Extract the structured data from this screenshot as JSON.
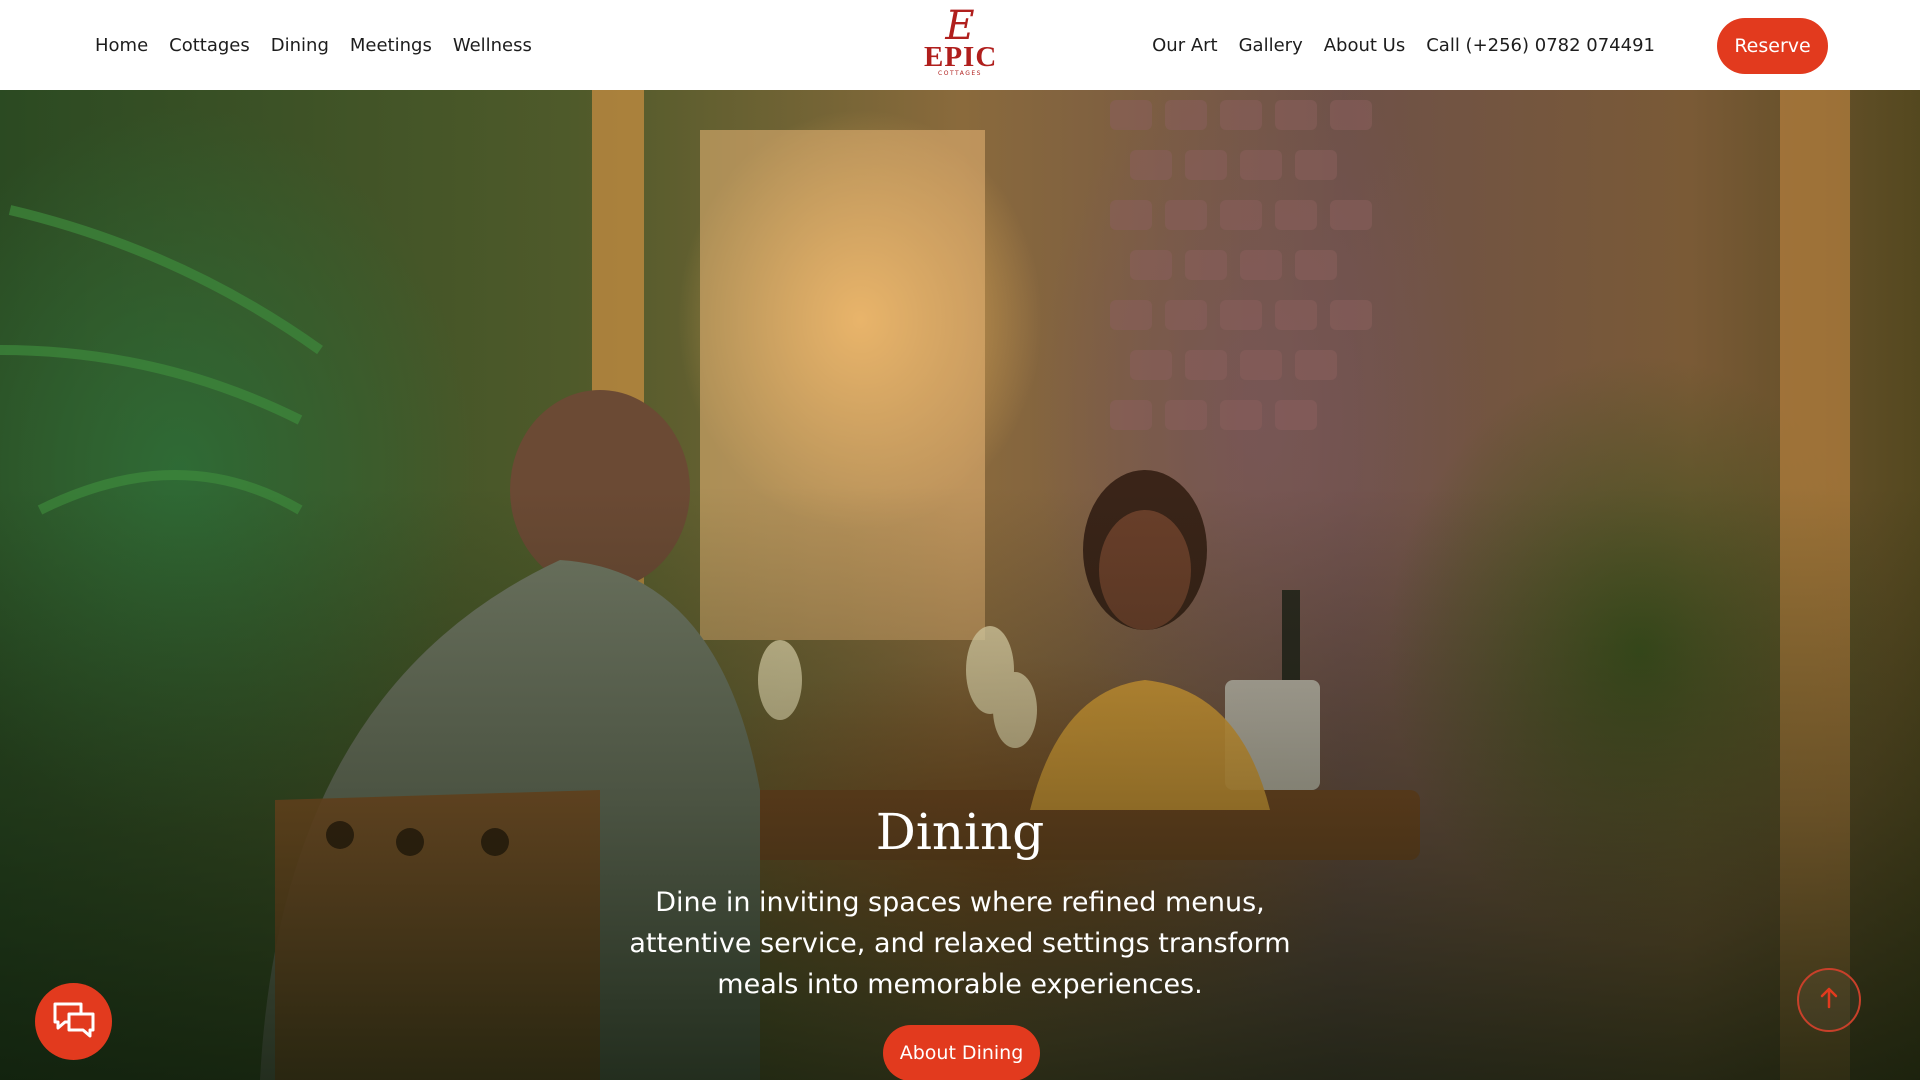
{
  "header": {
    "nav_left": [
      {
        "label": "Home"
      },
      {
        "label": "Cottages"
      },
      {
        "label": "Dining"
      },
      {
        "label": "Meetings"
      },
      {
        "label": "Wellness"
      }
    ],
    "logo": {
      "script_letter": "E",
      "wordmark": "EPIC",
      "subtitle": "COTTAGES",
      "color": "#b01f1d"
    },
    "nav_right": [
      {
        "label": "Our Art"
      },
      {
        "label": "Gallery"
      },
      {
        "label": "About Us"
      },
      {
        "label": "Call (+256) 0782 074491"
      }
    ],
    "reserve_label": "Reserve"
  },
  "hero": {
    "title": "Dining",
    "description": "Dine in inviting spaces where refined menus, attentive service, and relaxed settings transform meals into memorable experiences.",
    "cta_label": "About Dining",
    "image_subject": "couple dining at a wooden table beside palm foliage at sunset"
  },
  "floating": {
    "chat_icon": "chat-bubbles-icon",
    "scroll_top_icon": "arrow-up-icon"
  },
  "colors": {
    "accent": "#e23a1e",
    "header_bg": "#ffffff",
    "nav_text": "#1d1d1d"
  }
}
